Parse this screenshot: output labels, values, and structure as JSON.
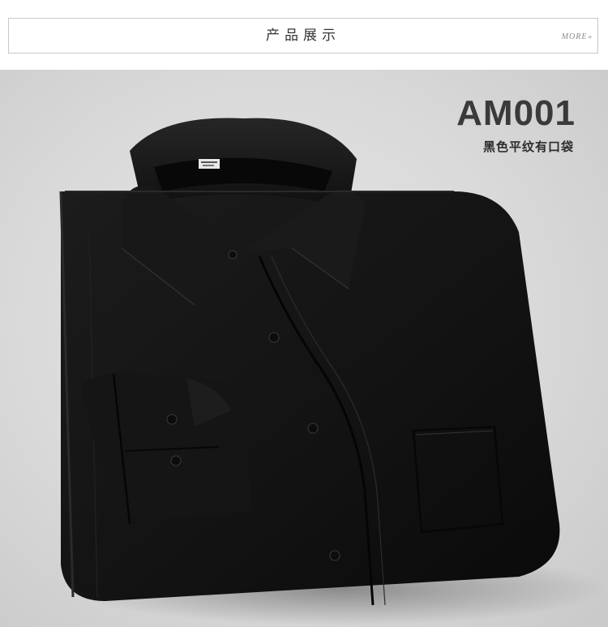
{
  "header": {
    "title": "产品展示",
    "more_label": "MORE",
    "more_icon": "double-chevron-down-icon"
  },
  "product": {
    "model_code": "AM001",
    "description": "黑色平纹有口袋",
    "colors": {
      "shirt": "#141414",
      "background": "#d9d9d9",
      "code_text": "#3a3a3a"
    }
  }
}
